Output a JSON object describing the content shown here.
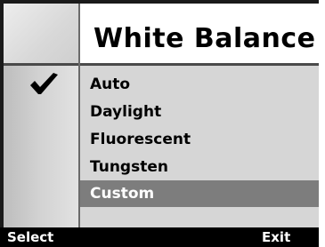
{
  "menu": {
    "title": "White Balance",
    "items": [
      {
        "label": "Auto",
        "checked": true
      },
      {
        "label": "Daylight"
      },
      {
        "label": "Fluorescent"
      },
      {
        "label": "Tungsten"
      },
      {
        "label": "Custom",
        "highlighted": true
      }
    ]
  },
  "softkeys": {
    "left": "Select",
    "right": "Exit"
  },
  "icons": {
    "check": "checkmark-icon"
  },
  "colors": {
    "highlight": "#7d7d7d",
    "list_bg": "#d6d6d6",
    "softbar_bg": "#000000"
  }
}
